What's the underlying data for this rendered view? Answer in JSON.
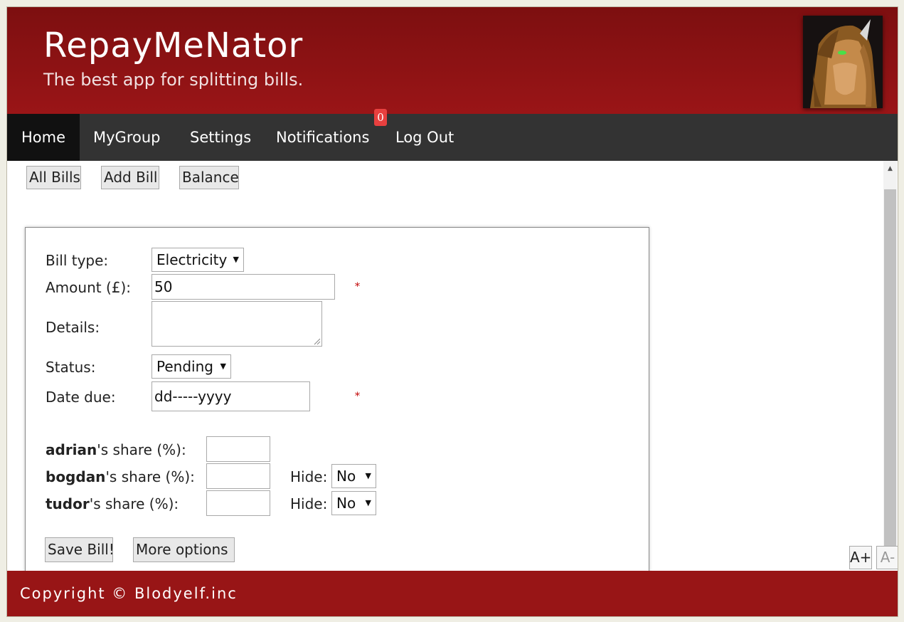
{
  "header": {
    "title": "RepayMeNator",
    "subtitle": "The best app for splitting bills."
  },
  "nav": {
    "items": [
      {
        "label": "Home",
        "active": true
      },
      {
        "label": "MyGroup"
      },
      {
        "label": "Settings"
      },
      {
        "label": "Notifications"
      },
      {
        "label": "Log Out"
      }
    ],
    "notifications_count": "0"
  },
  "subnav": {
    "all_bills": "All Bills",
    "add_bill": "Add Bill",
    "balance": "Balance"
  },
  "form": {
    "bill_type_label": "Bill type:",
    "bill_type_value": "Electricity",
    "amount_label": "Amount (£):",
    "amount_value": "50",
    "details_label": "Details:",
    "details_value": "",
    "status_label": "Status:",
    "status_value": "Pending",
    "date_label": "Date due:",
    "date_value": "dd-----yyyy",
    "required_mark": "*",
    "shares": [
      {
        "user": "adrian",
        "suffix": "'s share (%):",
        "value": ""
      },
      {
        "user": "bogdan",
        "suffix": "'s share (%):",
        "value": "",
        "hide_label": "Hide:",
        "hide_value": "No"
      },
      {
        "user": "tudor",
        "suffix": "'s share (%):",
        "value": "",
        "hide_label": "Hide:",
        "hide_value": "No"
      }
    ],
    "save_label": "Save Bill!",
    "more_label": "More options"
  },
  "font_controls": {
    "increase": "A+",
    "decrease": "A-"
  },
  "footer": {
    "copyright": "Copyright © Blodyelf.inc"
  },
  "colors": {
    "header_red": "#8b1214",
    "nav_dark": "#333333",
    "nav_active": "#111111",
    "badge_red": "#e8403f",
    "required_red": "#c00000"
  }
}
